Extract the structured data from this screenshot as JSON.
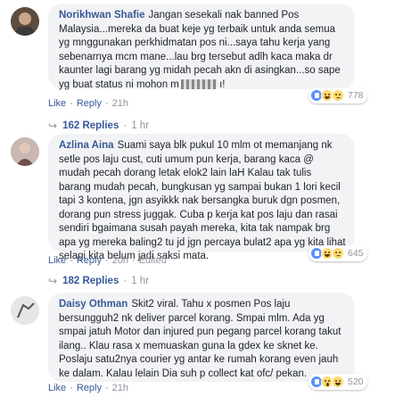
{
  "comments": [
    {
      "author": "Norikhwan Shafie",
      "text": "Jangan sesekali nak banned Pos Malaysia...mereka da buat keje yg terbaik untuk anda semua yg mnggunakan perkhidmatan pos ni...saya tahu kerja yang sebenarnya mcm mane...lau brg tersebut adlh kaca maka dr kaunter lagi barang yg midah pecah akn di asingkan...so sape yg buat status ni mohon m",
      "like_label": "Like",
      "reply_label": "Reply",
      "time": "21h",
      "reaction_count": "778",
      "reactions": [
        "like-icon",
        "haha-icon",
        "sad-icon"
      ],
      "replies_label": "162 Replies",
      "replies_time": "1 hr",
      "avatar_color": "#7a6a5c"
    },
    {
      "author": "Azlina Aina",
      "text": "Suami saya blk pukul 10 mlm ot memanjang nk setle pos laju cust, cuti umum pun kerja, barang kaca @ mudah pecah dorang letak elok2 lain laH Kalau tak tulis barang mudah pecah, bungkusan yg sampai bukan 1 lori kecil tapi 3 kontena, jgn asyikkk nak bersangka buruk dgn posmen, dorang pun stress juggak. Cuba p kerja kat pos laju dan rasai sendiri bgaimana susah payah mereka, kita tak nampak brg apa yg mereka baling2 tu jd jgn percaya bulat2 apa yg kita lihat selagi kita belum jadi saksi mata.",
      "like_label": "Like",
      "reply_label": "Reply",
      "time": "20h",
      "edited": "Edited",
      "reaction_count": "645",
      "reactions": [
        "like-icon",
        "haha-icon",
        "sad-icon"
      ],
      "replies_label": "182 Replies",
      "replies_time": "1 hr",
      "avatar_color": "#b9a7a4"
    },
    {
      "author": "Daisy Othman",
      "text": "Skit2 viral. Tahu x posmen Pos laju bersungguh2 nk deliver parcel korang. Smpai mlm. Ada yg smpai jatuh Motor dan injured pun pegang parcel korang takut ilang.. Klau rasa x memuaskan guna la gdex ke sknet ke. Poslaju satu2nya courier yg antar ke rumah korang even jauh ke dalam. Kalau lelain Dia suh p collect kat ofc/ pekan.",
      "like_label": "Like",
      "reply_label": "Reply",
      "time": "21h",
      "reaction_count": "520",
      "reactions": [
        "like-icon",
        "wow-icon",
        "haha-icon"
      ],
      "avatar_color": "#d8d8d8"
    }
  ]
}
